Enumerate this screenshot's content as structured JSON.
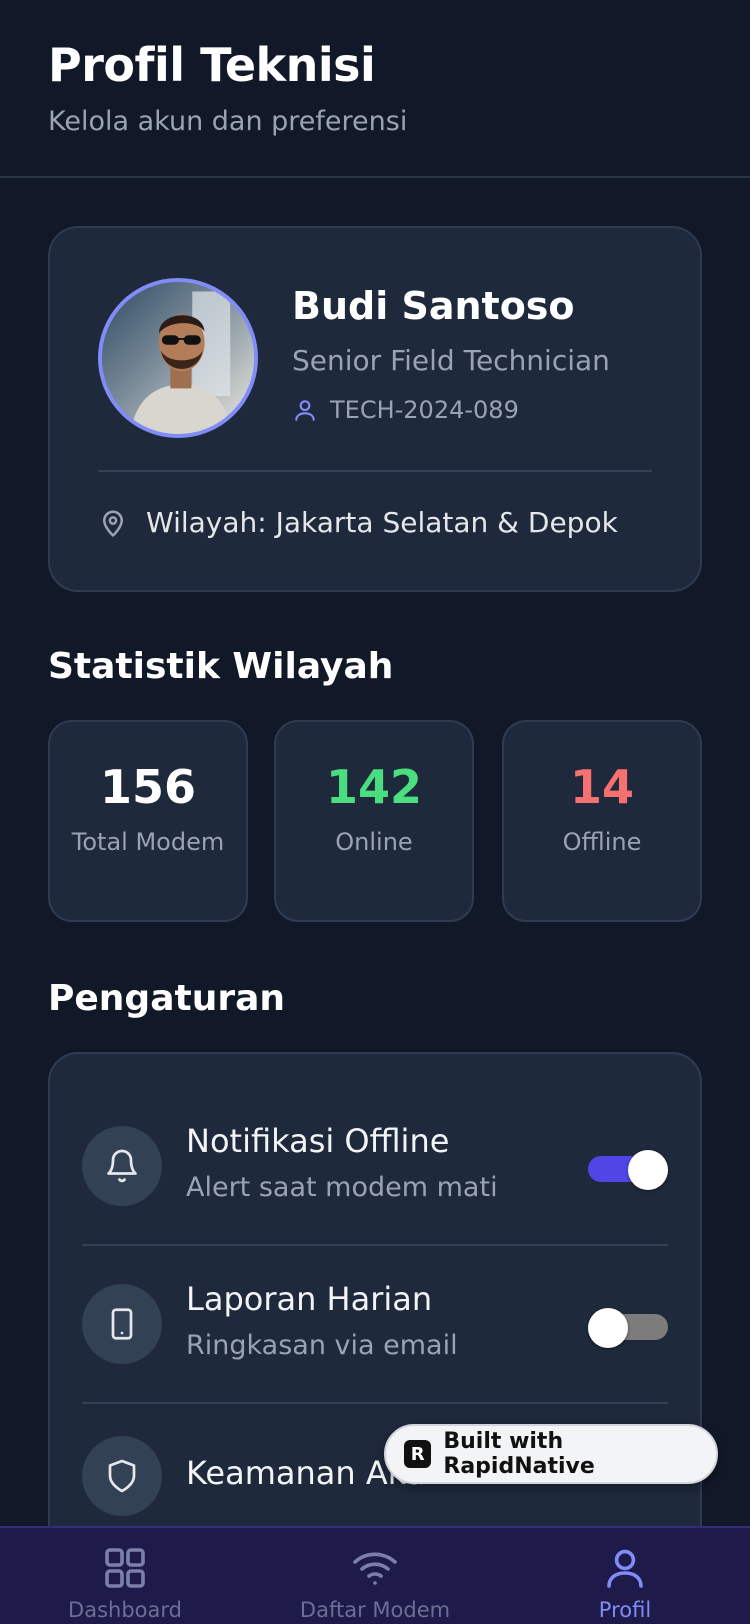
{
  "header": {
    "title": "Profil Teknisi",
    "subtitle": "Kelola akun dan preferensi"
  },
  "profile": {
    "name": "Budi Santoso",
    "role": "Senior Field Technician",
    "tech_id": "TECH-2024-089",
    "region": "Wilayah: Jakarta Selatan & Depok",
    "avatar_icon": "user-photo"
  },
  "stats": {
    "title": "Statistik Wilayah",
    "items": [
      {
        "value": "156",
        "label": "Total Modem",
        "color": "#ffffff"
      },
      {
        "value": "142",
        "label": "Online",
        "color": "#4ade80"
      },
      {
        "value": "14",
        "label": "Offline",
        "color": "#f87171"
      }
    ]
  },
  "settings": {
    "title": "Pengaturan",
    "items": [
      {
        "title": "Notifikasi Offline",
        "subtitle": "Alert saat modem mati",
        "icon": "bell-icon",
        "enabled": true
      },
      {
        "title": "Laporan Harian",
        "subtitle": "Ringkasan via email",
        "icon": "phone-icon",
        "enabled": false
      },
      {
        "title": "Keamanan Akun",
        "icon": "shield-icon"
      }
    ]
  },
  "badge": {
    "text": "Built with RapidNative",
    "logo": "R"
  },
  "nav": {
    "items": [
      {
        "label": "Dashboard",
        "icon": "grid-icon",
        "active": false
      },
      {
        "label": "Daftar Modem",
        "icon": "wifi-icon",
        "active": false
      },
      {
        "label": "Profil",
        "icon": "user-icon",
        "active": true
      }
    ]
  },
  "colors": {
    "accent": "#818cf8",
    "toggle_on": "#4f46e5",
    "background": "#111827",
    "card": "#1e293b"
  }
}
